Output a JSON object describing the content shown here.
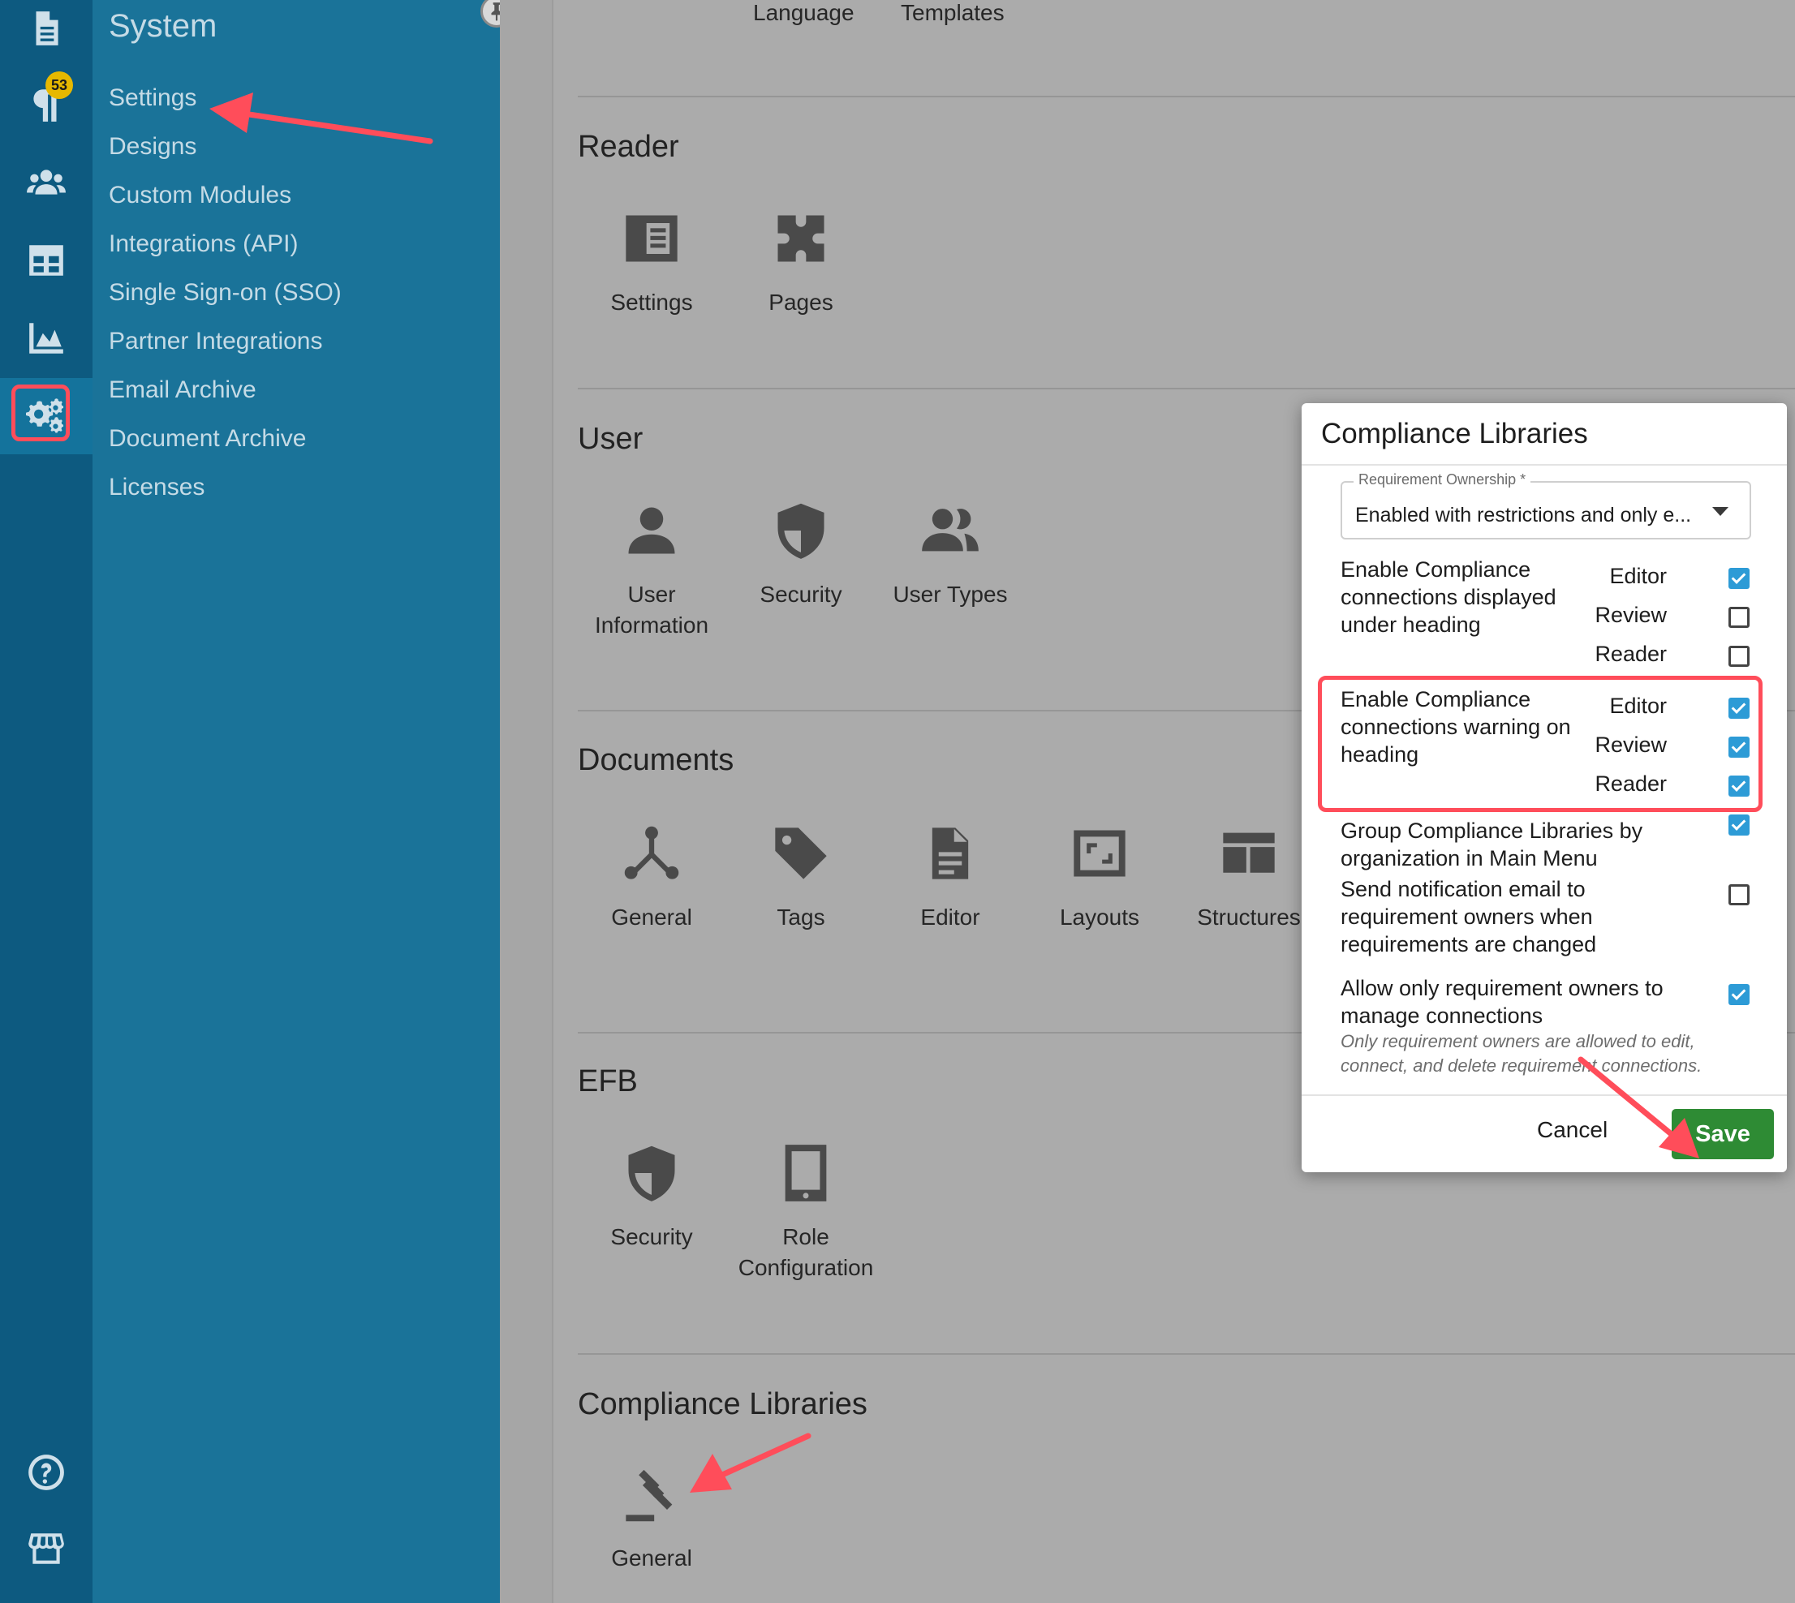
{
  "nav_rail": {
    "notification_count": "53",
    "icons": [
      "document-icon",
      "paragraph-icon",
      "users-icon",
      "grid-icon",
      "chart-icon",
      "settings-gears-icon",
      "help-icon",
      "store-icon"
    ],
    "active": "settings-gears-icon"
  },
  "system_menu": {
    "title": "System",
    "items": [
      {
        "label": "Settings"
      },
      {
        "label": "Designs"
      },
      {
        "label": "Custom Modules"
      },
      {
        "label": "Integrations (API)"
      },
      {
        "label": "Single Sign-on (SSO)"
      },
      {
        "label": "Partner Integrations"
      },
      {
        "label": "Email Archive"
      },
      {
        "label": "Document Archive"
      },
      {
        "label": "Licenses"
      }
    ]
  },
  "content": {
    "top_links": [
      "Language",
      "Templates"
    ],
    "sections": [
      {
        "title": "Reader",
        "tiles": [
          {
            "label": "Settings",
            "icon": "sidebar-layout-icon"
          },
          {
            "label": "Pages",
            "icon": "puzzle-icon"
          }
        ]
      },
      {
        "title": "User",
        "tiles": [
          {
            "label": "User Information",
            "icon": "person-icon"
          },
          {
            "label": "Security",
            "icon": "shield-icon"
          },
          {
            "label": "User Types",
            "icon": "user-group-icon"
          }
        ]
      },
      {
        "title": "Documents",
        "tiles": [
          {
            "label": "General",
            "icon": "branch-icon"
          },
          {
            "label": "Tags",
            "icon": "tag-icon"
          },
          {
            "label": "Editor",
            "icon": "file-text-icon"
          },
          {
            "label": "Layouts",
            "icon": "frame-icon"
          },
          {
            "label": "Structures",
            "icon": "structure-icon"
          }
        ]
      },
      {
        "title": "EFB",
        "tiles": [
          {
            "label": "Security",
            "icon": "shield-icon"
          },
          {
            "label": "Role Configuration",
            "icon": "tablet-icon"
          }
        ]
      },
      {
        "title": "Compliance Libraries",
        "tiles": [
          {
            "label": "General",
            "icon": "gavel-icon"
          }
        ]
      }
    ]
  },
  "modal": {
    "title": "Compliance Libraries",
    "requirement_ownership": {
      "label": "Requirement Ownership *",
      "value": "Enabled with restrictions and only e..."
    },
    "options": [
      {
        "text": "Enable Compliance connections displayed under heading",
        "roles": [
          {
            "name": "Editor",
            "checked": true
          },
          {
            "name": "Review",
            "checked": false
          },
          {
            "name": "Reader",
            "checked": false
          }
        ]
      },
      {
        "text": "Enable Compliance connections warning on heading",
        "roles": [
          {
            "name": "Editor",
            "checked": true
          },
          {
            "name": "Review",
            "checked": true
          },
          {
            "name": "Reader",
            "checked": true
          }
        ]
      },
      {
        "text": "Group Compliance Libraries by organization in Main Menu",
        "checked": true
      },
      {
        "text": "Send notification email to requirement owners when requirements are changed",
        "checked": false
      },
      {
        "text": "Allow only requirement owners to manage connections",
        "hint": "Only requirement owners are allowed to edit, connect, and delete requirement connections.",
        "checked": true
      }
    ],
    "cancel_label": "Cancel",
    "save_label": "Save"
  },
  "colors": {
    "rail": "#0d5a80",
    "menu": "#1a7399",
    "annotation": "#ff4d5a",
    "checkbox_on": "#2d9bd6",
    "save_button": "#2e8b34"
  }
}
